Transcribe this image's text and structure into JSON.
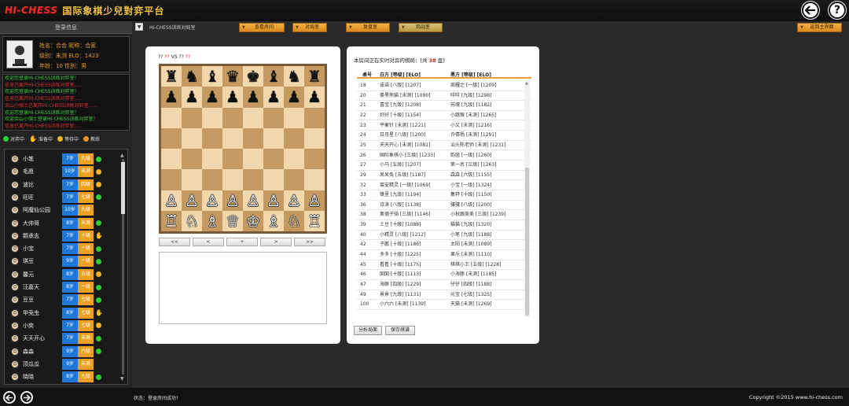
{
  "header": {
    "brand": "HI-CHESS",
    "title": "国际象棋少兒對弈平台",
    "back_icon": "back-arrow-icon",
    "help_icon": "help-icon",
    "help_label": "?"
  },
  "toolbar": {
    "login_title": "登录信息",
    "room_name": "HI-CHESS训练对局室",
    "buttons": [
      "查看房间",
      "对局室",
      "复盘室",
      "观战室"
    ],
    "home_button": "返回主界面"
  },
  "profile": {
    "line1": "姓名：合合  昵称：合家",
    "line2": "级别：未测  ELO：1423",
    "line3": "年龄：10  性别：男"
  },
  "messages": [
    {
      "text": "欢迎您登录HI-CHESS训练对弈室！",
      "color": "green"
    },
    {
      "text": "信息已离开HI-CHESS训练对弈室……",
      "color": "red"
    },
    {
      "text": "欢迎您登录HI-CHESS训练对弈室！",
      "color": "green"
    },
    {
      "text": "信息已离开HI-CHESS训练对弈室……",
      "color": "red"
    },
    {
      "text": "余山小骑士已离开HI-CHESS训练对弈室……",
      "color": "red"
    },
    {
      "text": "欢迎您登录HI-CHESS训练对弈室！",
      "color": "green"
    },
    {
      "text": "欢迎余山小骑士登录HI-CHESS训练对弈室！",
      "color": "green"
    },
    {
      "text": "信息已离开HI-CHESS训练对弈室……",
      "color": "red"
    }
  ],
  "legend": {
    "playing": "对弈中",
    "preparing": "准备中",
    "waiting": "等待中",
    "watching": "教练"
  },
  "players": [
    {
      "name": "小笔",
      "level": "7岁",
      "rank": "九级",
      "status": "green"
    },
    {
      "name": "毛愿",
      "level": "10岁",
      "rank": "未测",
      "status": "yellow"
    },
    {
      "name": "波比",
      "level": "7岁",
      "rank": "四级",
      "status": "yellow"
    },
    {
      "name": "旺旺",
      "level": "7岁",
      "rank": "七级",
      "status": "green"
    },
    {
      "name": "阿魔仙公园",
      "level": "10岁",
      "rank": "九级",
      "status": "none"
    },
    {
      "name": "大帅哥",
      "level": "8岁",
      "rank": "未测",
      "status": "green"
    },
    {
      "name": "颗承志",
      "level": "7岁",
      "rank": "十级",
      "status": "hand"
    },
    {
      "name": "小宝",
      "level": "7岁",
      "rank": "一级",
      "status": "green"
    },
    {
      "name": "琪豆",
      "level": "9岁",
      "rank": "一级",
      "status": "green"
    },
    {
      "name": "馨元",
      "level": "8岁",
      "rank": "五级",
      "status": "yellow"
    },
    {
      "name": "汪嘉天",
      "level": "8岁",
      "rank": "一级",
      "status": "green"
    },
    {
      "name": "豆豆",
      "level": "7岁",
      "rank": "七级",
      "status": "green"
    },
    {
      "name": "甲壳虫",
      "level": "8岁",
      "rank": "七级",
      "status": "hand"
    },
    {
      "name": "小奕",
      "level": "7岁",
      "rank": "七级",
      "status": "yellow"
    },
    {
      "name": "天天开心",
      "level": "7岁",
      "rank": "未测",
      "status": "green"
    },
    {
      "name": "森森",
      "level": "9岁",
      "rank": "六级",
      "status": "green"
    },
    {
      "name": "顶瓜瓜",
      "level": "9岁",
      "rank": "未测",
      "status": "none"
    },
    {
      "name": "晓晓",
      "level": "8岁",
      "rank": "九级",
      "status": "green"
    }
  ],
  "board_panel": {
    "white_player": "??",
    "white_rating": "??",
    "vs": "VS",
    "black_player": "??",
    "black_rating": "??",
    "nav": [
      "<<",
      "<",
      "+",
      ">",
      ">>"
    ],
    "pieces": {
      "row0": [
        "♜",
        "♞",
        "♝",
        "♛",
        "♚",
        "♝",
        "♞",
        "♜"
      ],
      "row1": [
        "♟",
        "♟",
        "♟",
        "♟",
        "♟",
        "♟",
        "♟",
        "♟"
      ],
      "row6": [
        "♙",
        "♙",
        "♙",
        "♙",
        "♙",
        "♙",
        "♙",
        "♙"
      ],
      "row7": [
        "♖",
        "♘",
        "♗",
        "♕",
        "♔",
        "♗",
        "♘",
        "♖"
      ]
    }
  },
  "games": {
    "title_prefix": "本房间正在实时对弈的棋局：[共 ",
    "count": "38",
    "title_suffix": " 盘]",
    "headers": [
      "桌号",
      "白方 [等级] [ELO]",
      "黑方 [等级] [ELO]"
    ],
    "rows": [
      [
        "18",
        "诺诺 [八级] [1207]",
        "周耀之 [一级] [1209]"
      ],
      [
        "20",
        "豪黑熊猫 [未测] [1090]",
        "咩咩 [九级] [1298]"
      ],
      [
        "21",
        "喜宝 [九级] [1208]",
        "苏魂 [九级] [1182]"
      ],
      [
        "22",
        "好好 [十级] [1154]",
        "小跳猴 [未测] [1265]"
      ],
      [
        "23",
        "平衡针 [未测] [1221]",
        "小文 [未测] [1216]"
      ],
      [
        "24",
        "日月星 [八级] [1200]",
        "许倩杨 [未测] [1291]"
      ],
      [
        "25",
        "天天开心 [未测] [1081]",
        "汕头陈老师 [未测] [1231]"
      ],
      [
        "26",
        "国际象棋小 [三级] [1233]",
        "韵茵 [一级] [1260]"
      ],
      [
        "27",
        "小马 [五级] [1207]",
        "第一名 [三级] [1263]"
      ],
      [
        "29",
        "呆呆兔 [五级] [1187]",
        "森森 [六级] [1155]"
      ],
      [
        "32",
        "苗安精灵 [一级] [1069]",
        "小宝 [一级] [1324]"
      ],
      [
        "33",
        "锋里 [九级] [1194]",
        "集轩 [十级] [1150]"
      ],
      [
        "36",
        "诗涛 [八级] [1138]",
        "骧骧 [八级] [1200]"
      ],
      [
        "38",
        "奥德子骑 [三级] [1146]",
        "小秋跟美美 [三级] [1239]"
      ],
      [
        "39",
        "土豆 [十级] [1088]",
        "猫猫 [九级] [1320]"
      ],
      [
        "40",
        "小精灵 [八级] [1212]",
        "小笔 [九级] [1188]"
      ],
      [
        "42",
        "子鹏 [十级] [1186]",
        "太阳 [未测] [1089]"
      ],
      [
        "44",
        "多多 [十级] [1225]",
        "果乐 [未测] [1110]"
      ],
      [
        "45",
        "看看 [十级] [1175]",
        "棋棋小王 [五级] [1228]"
      ],
      [
        "46",
        "囡囡 [十级] [1113]",
        "小海豚 [未测] [1185]"
      ],
      [
        "47",
        "海豚 [四级] [1229]",
        "仔仔 [四级] [1188]"
      ],
      [
        "49",
        "景景 [九级] [1131]",
        "元宝 [七级] [1325]"
      ],
      [
        "100",
        "小六六 [未测] [1139]",
        "天猫 [未测] [1269]"
      ]
    ],
    "btn_analyze": "分析局面",
    "btn_save": "保存棋谱"
  },
  "bottom": {
    "status": "状态：登录房间成功！",
    "copyright": "Copyright ©2015 www.hi-chess.com"
  },
  "colors": {
    "accent_orange": "#f0a020",
    "level_blue": "#1e78d8",
    "status_green": "#2ed02e",
    "brand_red": "#e23030"
  }
}
